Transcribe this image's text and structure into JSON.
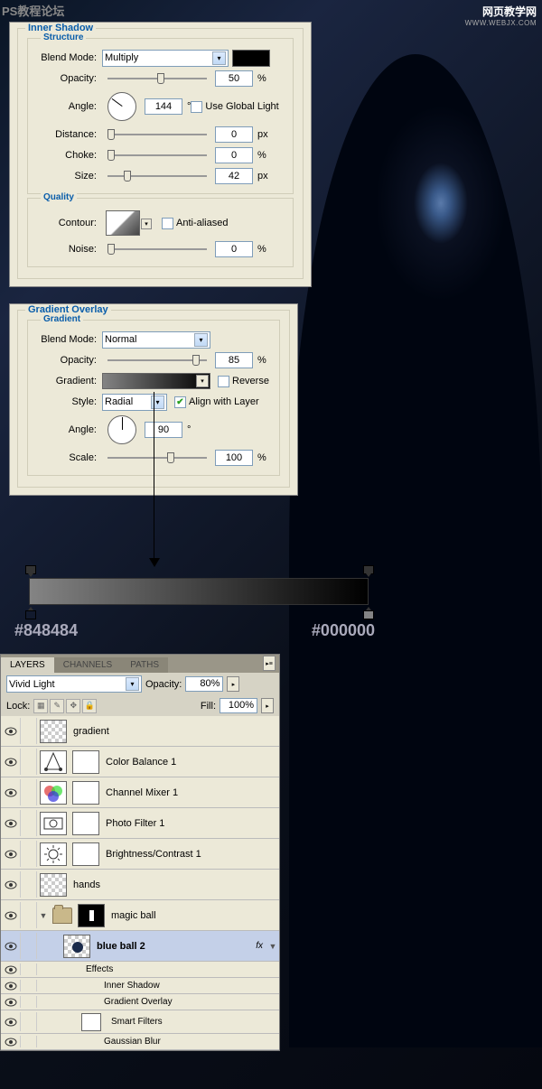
{
  "watermark": {
    "tl": "PS教程论坛",
    "tr_cn": "网页教学网",
    "tr_url": "WWW.WEBJX.COM"
  },
  "innerShadow": {
    "title": "Inner Shadow",
    "structure": "Structure",
    "blendModeLabel": "Blend Mode:",
    "blendMode": "Multiply",
    "opacityLabel": "Opacity:",
    "opacity": "50",
    "angleLabel": "Angle:",
    "angle": "144",
    "angleUnit": "°",
    "useGlobal": "Use Global Light",
    "distanceLabel": "Distance:",
    "distance": "0",
    "chokeLabel": "Choke:",
    "choke": "0",
    "sizeLabel": "Size:",
    "size": "42",
    "px": "px",
    "pct": "%",
    "quality": "Quality",
    "contourLabel": "Contour:",
    "antiAliased": "Anti-aliased",
    "noiseLabel": "Noise:",
    "noise": "0"
  },
  "gradientOverlay": {
    "title": "Gradient Overlay",
    "gradient": "Gradient",
    "blendModeLabel": "Blend Mode:",
    "blendMode": "Normal",
    "opacityLabel": "Opacity:",
    "opacity": "85",
    "pct": "%",
    "gradientLabel": "Gradient:",
    "reverse": "Reverse",
    "styleLabel": "Style:",
    "style": "Radial",
    "alignLayer": "Align with Layer",
    "angleLabel": "Angle:",
    "angle": "90",
    "angleUnit": "°",
    "scaleLabel": "Scale:",
    "scale": "100"
  },
  "gradientStops": {
    "left": "#848484",
    "right": "#000000"
  },
  "layersPanel": {
    "tabs": {
      "layers": "LAYERS",
      "channels": "CHANNELS",
      "paths": "PATHS"
    },
    "blendMode": "Vivid Light",
    "opacityLabel": "Opacity:",
    "opacity": "80%",
    "lockLabel": "Lock:",
    "fillLabel": "Fill:",
    "fill": "100%",
    "layers": {
      "gradient": "gradient",
      "colorBalance": "Color Balance 1",
      "channelMixer": "Channel Mixer 1",
      "photoFilter": "Photo Filter 1",
      "brightnessContrast": "Brightness/Contrast 1",
      "hands": "hands",
      "magicBall": "magic ball",
      "blueBall2": "blue ball 2",
      "effects": "Effects",
      "innerShadow": "Inner Shadow",
      "gradientOverlay": "Gradient Overlay",
      "smartFilters": "Smart Filters",
      "gaussianBlur": "Gaussian Blur",
      "fx": "fx"
    }
  }
}
